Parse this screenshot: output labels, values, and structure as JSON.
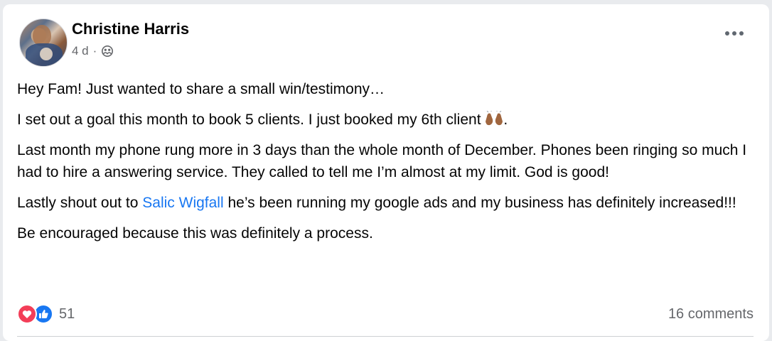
{
  "post": {
    "author": "Christine Harris",
    "time": "4 d",
    "separator": "·",
    "audience_icon": "friends-icon",
    "more_icon": "more-options-icon",
    "paragraphs": {
      "p1": "Hey Fam! Just wanted to share a small win/testimony…",
      "p2_before": "I set out a goal this month to book 5 clients. I just booked my 6th client ",
      "p2_emoji": "raising-hands-emoji",
      "p2_after": ".",
      "p3": "Last month my phone rung more in 3 days than the whole month of December. Phones been ringing so much I had to hire a answering service. They called to tell me I’m almost at my limit. God is good!",
      "p4_before": "Lastly shout out to ",
      "p4_mention": "Salic Wigfall",
      "p4_after": " he’s been running my google ads and my business has definitely increased!!!",
      "p5": "Be encouraged because this was definitely a process."
    },
    "reactions": {
      "icons": [
        "love-icon",
        "like-icon"
      ],
      "count": "51"
    },
    "comments": "16 comments",
    "colors": {
      "link": "#1877f2",
      "love": "#f33e58",
      "like": "#1877f2",
      "secondary_text": "#65676b"
    }
  }
}
